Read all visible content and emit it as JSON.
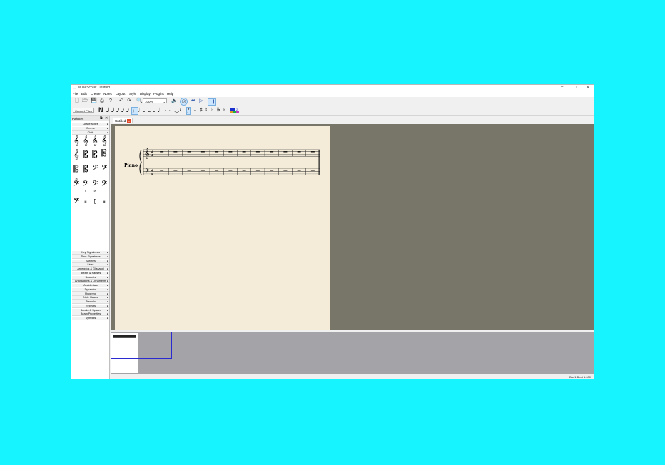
{
  "window": {
    "title": "MuseScore: Untitled",
    "min_glyph": "–",
    "max_glyph": "☐",
    "close_glyph": "✕"
  },
  "menu": [
    "File",
    "Edit",
    "Create",
    "Notes",
    "Layout",
    "Style",
    "Display",
    "Plugins",
    "Help"
  ],
  "toolbar": {
    "zoom_value": "100%",
    "concert_pitch_label": "Concert Pitch"
  },
  "palettes": {
    "header_label": "Palettes",
    "sections_top": [
      "Grace Notes",
      "Drums",
      "Clefs"
    ],
    "clef_captions": [
      "15",
      "8",
      "15"
    ],
    "sections_bottom": [
      "Key Signatures",
      "Time Signatures",
      "Barlines",
      "Lines",
      "Arpeggios & Glissandi",
      "Breath & Pauses",
      "Brackets",
      "Articulations & Ornaments",
      "Accidentals",
      "Dynamics",
      "Fingering",
      "Note Heads",
      "Tremolo",
      "Repeats",
      "Breaks & Spacer",
      "Beam Properties",
      "Symbols"
    ]
  },
  "tab": {
    "label": "Untitled",
    "close_glyph": "x"
  },
  "score": {
    "instrument": "Piano",
    "measures": 12,
    "time_sig_top": "4",
    "time_sig_bottom": "4"
  },
  "status": {
    "position": "Bar  1 Beat  1.000"
  },
  "colors": {
    "desktop": "#16f4ff",
    "canvas": "#787569",
    "page": "#f4ecd9",
    "navigator": "#a4a3a8",
    "viewport_frame": "#2a2ad0"
  }
}
